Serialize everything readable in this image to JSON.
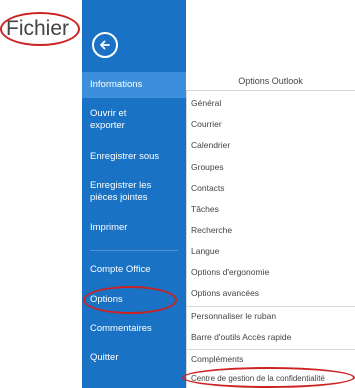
{
  "annotation": {
    "label": "Fichier",
    "highlight_color": "#cc2222"
  },
  "sidebar": {
    "background": "#1a72c4",
    "active_background": "#3b8fdb",
    "back_icon": "arrow-left-circle-icon",
    "items": [
      {
        "label": "Informations",
        "active": true
      },
      {
        "label": "Ouvrir et exporter"
      },
      {
        "label": "Enregistrer sous"
      },
      {
        "label": "Enregistrer les pièces jointes"
      },
      {
        "label": "Imprimer"
      },
      {
        "label": "Compte Office"
      },
      {
        "label": "Options",
        "highlighted": true
      },
      {
        "label": "Commentaires"
      },
      {
        "label": "Quitter"
      }
    ]
  },
  "dialog": {
    "title": "Options Outlook",
    "items": [
      {
        "label": "Général"
      },
      {
        "label": "Courrier"
      },
      {
        "label": "Calendrier"
      },
      {
        "label": "Groupes"
      },
      {
        "label": "Contacts"
      },
      {
        "label": "Tâches"
      },
      {
        "label": "Recherche"
      },
      {
        "label": "Langue"
      },
      {
        "label": "Options d'ergonomie"
      },
      {
        "label": "Options avancées"
      },
      {
        "label": "Personnaliser le ruban"
      },
      {
        "label": "Barre d'outils Accès rapide"
      },
      {
        "label": "Compléments"
      },
      {
        "label": "Centre de gestion de la confidentialité",
        "highlighted": true
      }
    ]
  }
}
